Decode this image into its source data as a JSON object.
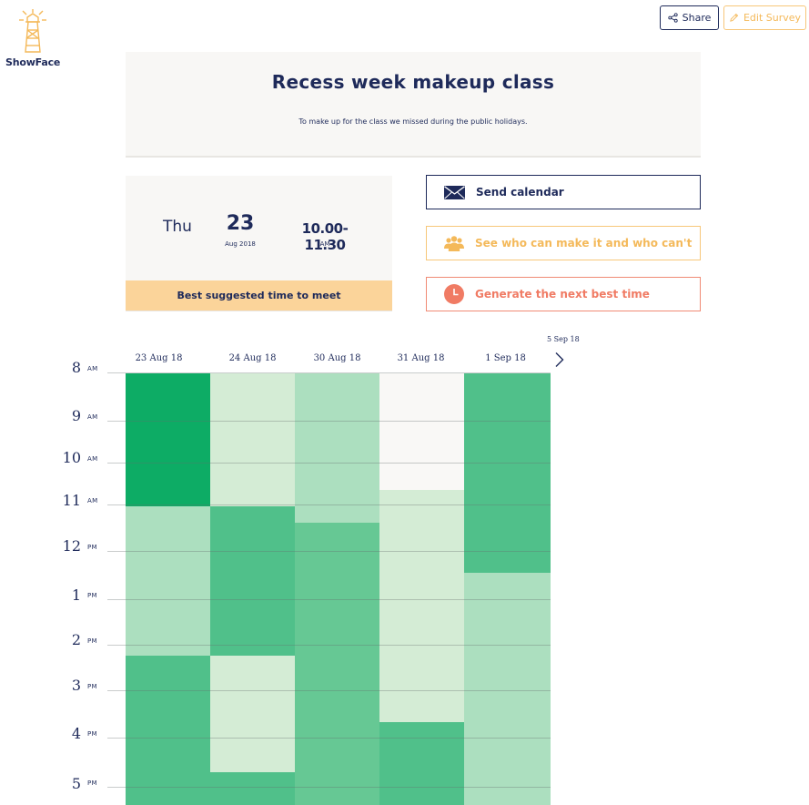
{
  "app": {
    "logo_text": "ShowFace"
  },
  "toolbar": {
    "share_label": "Share",
    "edit_label": "Edit Survey"
  },
  "survey": {
    "title": "Recess week makeup class",
    "description": "To make up for the class we missed during the public holidays."
  },
  "best_time": {
    "day": "Thu",
    "date": "23",
    "month_year": "Aug 2018",
    "time_range": "10.00-11.30",
    "ampm": "AM",
    "caption": "Best suggested time to meet"
  },
  "actions": {
    "send_calendar": "Send calendar",
    "who_can": "See who can make it and who can't",
    "generate_next": "Generate the next best time"
  },
  "calendar": {
    "columns": [
      "23 Aug 18",
      "24 Aug 18",
      "30 Aug 18",
      "31 Aug 18",
      "1 Sep 18"
    ],
    "next_column": "5 Sep 18",
    "hours": [
      {
        "num": "8",
        "ampm": "AM"
      },
      {
        "num": "9",
        "ampm": "AM"
      },
      {
        "num": "10",
        "ampm": "AM"
      },
      {
        "num": "11",
        "ampm": "AM"
      },
      {
        "num": "12",
        "ampm": "PM"
      },
      {
        "num": "1",
        "ampm": "PM"
      },
      {
        "num": "2",
        "ampm": "PM"
      },
      {
        "num": "3",
        "ampm": "PM"
      },
      {
        "num": "4",
        "ampm": "PM"
      },
      {
        "num": "5",
        "ampm": "PM"
      }
    ],
    "availability_hours": [
      [
        6,
        6,
        6,
        6,
        6,
        6,
        6,
        6,
        2,
        2,
        2,
        2,
        2,
        2,
        2,
        2,
        2,
        4,
        4,
        4,
        4,
        4,
        4,
        4,
        4,
        4
      ],
      [
        1,
        1,
        1,
        1,
        1,
        1,
        1,
        1,
        4,
        4,
        4,
        4,
        4,
        4,
        4,
        4,
        4,
        1,
        1,
        1,
        1,
        1,
        1,
        1,
        4,
        4
      ],
      [
        2,
        2,
        2,
        2,
        2,
        2,
        2,
        2,
        2,
        3,
        3,
        3,
        3,
        3,
        3,
        3,
        3,
        3,
        3,
        3,
        3,
        3,
        3,
        3,
        3,
        3
      ],
      [
        0,
        0,
        0,
        0,
        0,
        0,
        0,
        1,
        1,
        1,
        1,
        1,
        1,
        1,
        1,
        1,
        1,
        1,
        1,
        1,
        1,
        4,
        4,
        4,
        4,
        4
      ],
      [
        4,
        4,
        4,
        4,
        4,
        4,
        4,
        4,
        4,
        4,
        4,
        4,
        2,
        2,
        2,
        2,
        2,
        2,
        2,
        2,
        2,
        2,
        2,
        2,
        2,
        2
      ]
    ],
    "colors": {
      "0": "#f9f8f6",
      "1": "#d4ecd5",
      "2": "#acdfbf",
      "3": "#66c894",
      "4": "#50c08a",
      "6": "#0dac65"
    }
  },
  "colors": {
    "navy": "#1e2a5a",
    "accent_orange": "#f4b95a",
    "accent_red": "#f07b64",
    "best_bar": "#fbd49a"
  },
  "icons": {
    "logo": "lighthouse-icon",
    "share": "share-icon",
    "edit": "pencil-icon",
    "send": "envelope-icon",
    "who": "people-icon",
    "generate": "clock-icon",
    "next": "chevron-right-icon"
  }
}
